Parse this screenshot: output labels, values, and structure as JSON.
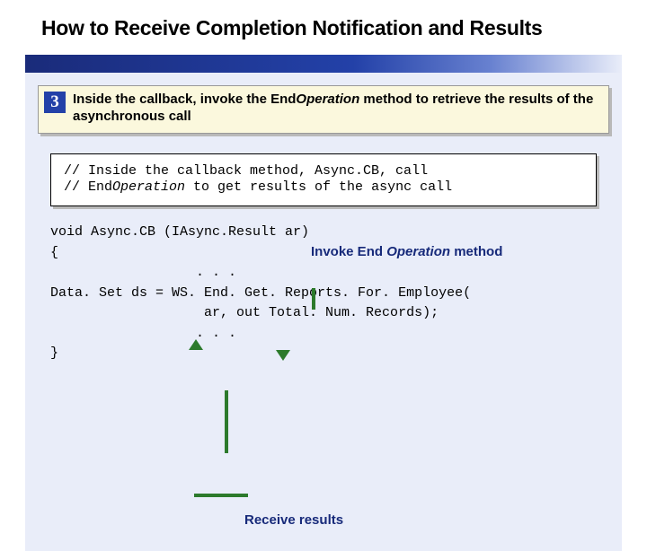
{
  "title": "How to Receive Completion Notification and Results",
  "step": {
    "number": "3",
    "text_before": "Inside the callback, invoke the End",
    "text_italic": "Operation",
    "text_after": " method to retrieve the results of the asynchronous call"
  },
  "code_top": {
    "line1_a": "// Inside the callback method, Async.CB, call",
    "line2_a": "// End",
    "line2_it": "Operation",
    "line2_b": " to get results of the async call"
  },
  "code_main": {
    "l1": "void Async.CB (IAsync.Result ar)",
    "l2": "{",
    "l3": "                  . . .",
    "l4": "Data. Set ds = WS. End. Get. Reports. For. Employee(",
    "l5": "                   ar, out Total. Num. Records);",
    "l6": "                  . . .",
    "l7": "}"
  },
  "annot_top_a": "Invoke End",
  "annot_top_it": " Operation",
  "annot_top_b": " method",
  "annot_bottom": "Receive results"
}
